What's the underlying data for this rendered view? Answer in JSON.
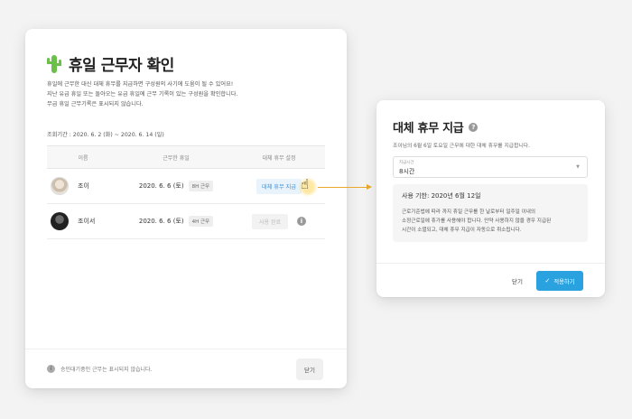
{
  "left_dialog": {
    "title": "휴일 근무자 확인",
    "desc_lines": [
      "휴일에 근무한 대신 대체 휴무를 지급하면 구성원의 사기에 도움이 될 수 있어요!",
      "지난 유급 휴일 또는 돌아오는 유급 휴일에 근무 기록이 있는 구성원을 확인합니다.",
      "무급 휴일 근무기록은 표시되지 않습니다."
    ],
    "period": "조회기간 : 2020. 6. 2 (화) ~ 2020. 6. 14 (일)",
    "columns": [
      "이름",
      "근무한 휴일",
      "대체 휴무 설정"
    ],
    "rows": [
      {
        "name": "조이",
        "date": "2020. 6. 6 (토)",
        "hours": "8H 근무",
        "action": "대체 휴무 지급"
      },
      {
        "name": "조이서",
        "date": "2020. 6. 6 (토)",
        "hours": "4H 근무",
        "action": "사용 완료"
      }
    ],
    "footer_note": "승인대기중인 근무는 표시되지 않습니다.",
    "close_label": "닫기"
  },
  "right_dialog": {
    "title": "대체 휴무 지급",
    "subtitle": "조이님의 6월 6일 토요일 근무에 대한 대체 휴무를 지급합니다.",
    "select_label": "지급시간",
    "select_value": "8시간",
    "notice_title": "사용 기한: 2020년 6월 12일",
    "notice_lines": [
      "근로기준법에 따라 까지 휴일 근무를 한 날로부터 일주일 이내의",
      "소정근로일에 휴가를 사용해야 합니다. 만약 사용하지 않을 경우 지급된",
      "시간이 소멸되고, 대체 휴무 지급이 자동으로 취소됩니다."
    ],
    "close_label": "닫기",
    "apply_label": "적용하기"
  },
  "icons": {
    "title_icon": "cactus-icon",
    "info": "info-icon",
    "help": "help-icon",
    "pointer": "hand-pointer-icon",
    "check": "check-icon"
  },
  "colors": {
    "accent": "#2aa2e0",
    "action_text": "#3a8fd8",
    "arrow": "#e8a92c",
    "cactus": "#6cbf4a"
  }
}
